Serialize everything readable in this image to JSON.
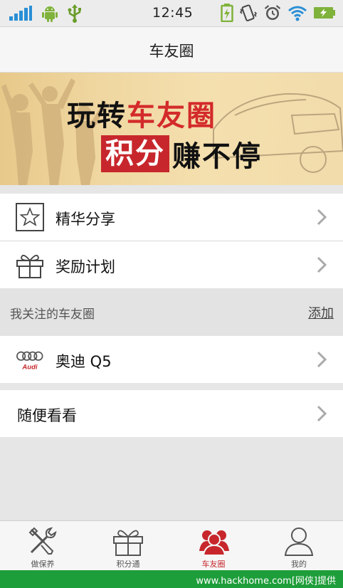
{
  "status_bar": {
    "time": "12:45",
    "icons": [
      "signal-icon",
      "android-icon",
      "usb-icon",
      "battery-charging-icon",
      "vibrate-icon",
      "alarm-icon",
      "wifi-icon",
      "battery-full-icon"
    ]
  },
  "header": {
    "title": "车友圈"
  },
  "banner": {
    "line1_a": "玩转",
    "line1_b": "车友圈",
    "line2_box": "积分",
    "line2_rest": "赚不停",
    "colors": {
      "red": "#d32a2a",
      "box_red": "#c7272c"
    }
  },
  "menu": [
    {
      "label": "精华分享",
      "icon": "star-icon"
    },
    {
      "label": "奖励计划",
      "icon": "gift-icon"
    }
  ],
  "followed": {
    "title": "我关注的车友圈",
    "add_label": "添加",
    "items": [
      {
        "label": "奥迪 Q5",
        "icon": "audi-logo-icon",
        "logo_text": "Audi"
      }
    ]
  },
  "browse": {
    "label": "随便看看"
  },
  "tabs": [
    {
      "label": "做保养",
      "icon": "tools-icon",
      "active": false
    },
    {
      "label": "积分通",
      "icon": "gift-icon",
      "active": false
    },
    {
      "label": "车友圈",
      "icon": "people-icon",
      "active": true
    },
    {
      "label": "我的",
      "icon": "user-icon",
      "active": false
    }
  ],
  "watermark": "www.hackhome.com[网侠]提供"
}
